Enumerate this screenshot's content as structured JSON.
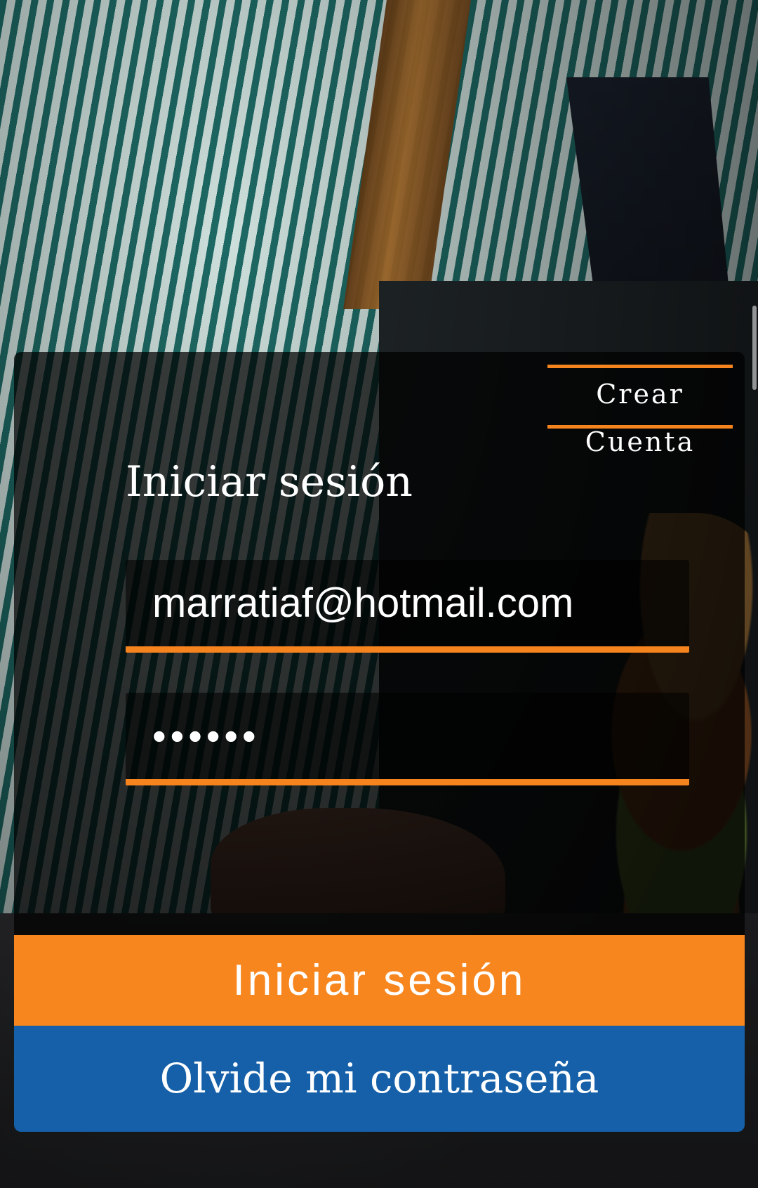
{
  "card": {
    "create_account": {
      "line1": "Crear",
      "line2": "Cuenta"
    },
    "title": "Iniciar sesión",
    "email": {
      "value": "marratiaf@hotmail.com"
    },
    "password": {
      "value": "••••••"
    },
    "login_button": "Iniciar sesión",
    "forgot_button": "Olvide mi contraseña"
  },
  "colors": {
    "accent": "#f7861f",
    "secondary": "#1560a8",
    "text": "#ffffff"
  },
  "background_image": "waiter-holding-burger-photo"
}
